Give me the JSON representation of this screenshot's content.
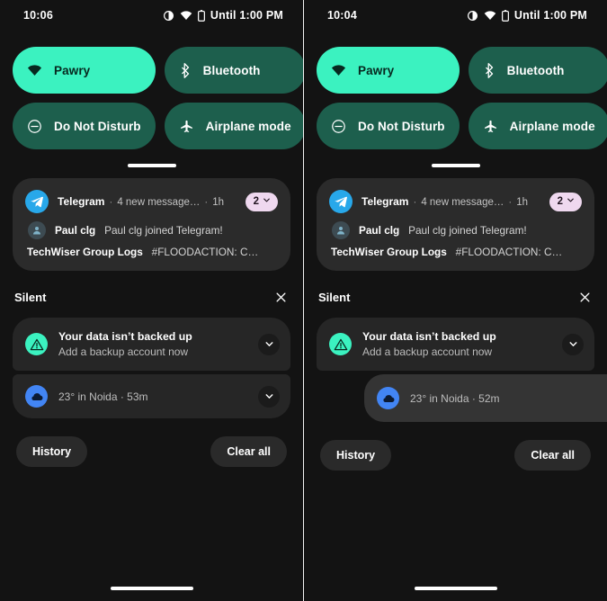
{
  "panels": [
    {
      "id": "left",
      "statusbar": {
        "clock": "10:06",
        "icons": [
          "contrast-icon",
          "wifi-icon",
          "battery-icon"
        ],
        "battery_text": "Until 1:00 PM"
      },
      "tiles": [
        {
          "label": "Pawry",
          "icon": "wifi-icon",
          "state": "on"
        },
        {
          "label": "Bluetooth",
          "icon": "bluetooth-icon",
          "state": "off"
        },
        {
          "label": "Do Not Disturb",
          "icon": "do-not-disturb-icon",
          "state": "off"
        },
        {
          "label": "Airplane mode",
          "icon": "airplane-icon",
          "state": "off"
        }
      ],
      "notification": {
        "app_name": "Telegram",
        "summary": "4 new message…",
        "time": "1h",
        "separator": "·",
        "count": "2",
        "message_sender": "Paul clg",
        "message_body": "Paul clg joined Telegram!",
        "message_line2_sender": "TechWiser Group Logs",
        "message_line2_body": "#FLOODACTION: C…"
      },
      "silent": {
        "label": "Silent",
        "close_icon": "close-icon",
        "backup": {
          "title": "Your data isn’t backed up",
          "subtitle": "Add a backup account now",
          "icon": "backup-warning-icon",
          "expand_icon": "chevron-down-icon"
        },
        "weather": {
          "text": "23° in Noida · 52m",
          "text_left": "23° in Noida · 53m",
          "icon": "weather-cloud-icon",
          "expand_icon": "chevron-down-icon",
          "dragged": false
        }
      },
      "footer": {
        "history_label": "History",
        "clear_all_label": "Clear all"
      }
    },
    {
      "id": "right",
      "statusbar": {
        "clock": "10:04",
        "icons": [
          "contrast-icon",
          "wifi-icon",
          "battery-icon"
        ],
        "battery_text": "Until 1:00 PM"
      },
      "tiles": [
        {
          "label": "Pawry",
          "icon": "wifi-icon",
          "state": "on"
        },
        {
          "label": "Bluetooth",
          "icon": "bluetooth-icon",
          "state": "off"
        },
        {
          "label": "Do Not Disturb",
          "icon": "do-not-disturb-icon",
          "state": "off"
        },
        {
          "label": "Airplane mode",
          "icon": "airplane-icon",
          "state": "off"
        }
      ],
      "notification": {
        "app_name": "Telegram",
        "summary": "4 new message…",
        "time": "1h",
        "separator": "·",
        "count": "2",
        "message_sender": "Paul clg",
        "message_body": "Paul clg joined Telegram!",
        "message_line2_sender": "TechWiser Group Logs",
        "message_line2_body": "#FLOODACTION: C…"
      },
      "silent": {
        "label": "Silent",
        "close_icon": "close-icon",
        "backup": {
          "title": "Your data isn’t backed up",
          "subtitle": "Add a backup account now",
          "icon": "backup-warning-icon",
          "expand_icon": "chevron-down-icon"
        },
        "weather": {
          "text": "23° in Noida · 52m",
          "icon": "weather-cloud-icon",
          "dragged": true
        }
      },
      "footer": {
        "history_label": "History",
        "clear_all_label": "Clear all"
      }
    }
  ],
  "colors": {
    "panel_bg": "#131313",
    "tile_on": "#3bf2c0",
    "tile_off": "#1d5f4d",
    "notif_card": "#2b2b2b",
    "silent_card": "#262626",
    "badge_pink": "#efd8ef",
    "telegram_blue": "#28a8ea",
    "weather_blue": "#4285f4"
  }
}
